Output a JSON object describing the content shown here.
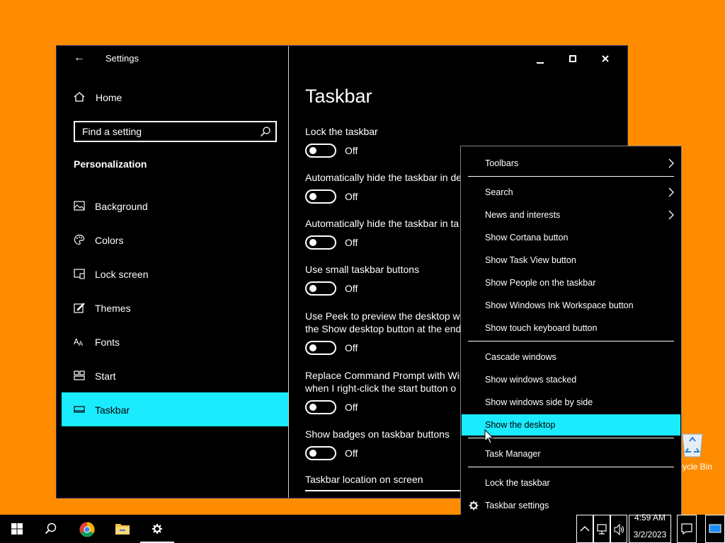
{
  "desktop": {
    "recycle_bin_label": "cycle Bin"
  },
  "window": {
    "app_title": "Settings",
    "home_label": "Home",
    "search_placeholder": "Find a setting",
    "section_title": "Personalization",
    "nav_items": [
      {
        "label": "Background",
        "icon": "image-icon"
      },
      {
        "label": "Colors",
        "icon": "palette-icon"
      },
      {
        "label": "Lock screen",
        "icon": "lock-screen-icon"
      },
      {
        "label": "Themes",
        "icon": "themes-icon"
      },
      {
        "label": "Fonts",
        "icon": "fonts-icon"
      },
      {
        "label": "Start",
        "icon": "start-icon"
      },
      {
        "label": "Taskbar",
        "icon": "taskbar-icon",
        "active": true
      }
    ]
  },
  "content": {
    "page_title": "Taskbar",
    "settings": [
      {
        "title": "Lock the taskbar",
        "state": "Off"
      },
      {
        "title": "Automatically hide the taskbar in de",
        "state": "Off"
      },
      {
        "title": "Automatically hide the taskbar in ta",
        "state": "Off"
      },
      {
        "title": "Use small taskbar buttons",
        "state": "Off"
      },
      {
        "title": "Use Peek to preview the desktop wh",
        "title2": "the Show desktop button at the end",
        "state": "Off"
      },
      {
        "title": "Replace Command Prompt with Win",
        "title2": "when I right-click the start button o",
        "state": "Off"
      },
      {
        "title": "Show badges on taskbar buttons",
        "state": "Off"
      }
    ],
    "location_label": "Taskbar location on screen"
  },
  "context_menu": {
    "items": [
      {
        "label": "Toolbars",
        "submenu": true
      },
      {
        "label": "Search",
        "submenu": true
      },
      {
        "label": "News and interests",
        "submenu": true
      },
      {
        "label": "Show Cortana button"
      },
      {
        "label": "Show Task View button"
      },
      {
        "label": "Show People on the taskbar"
      },
      {
        "label": "Show Windows Ink Workspace button"
      },
      {
        "label": "Show touch keyboard button"
      },
      {
        "label": "Cascade windows"
      },
      {
        "label": "Show windows stacked"
      },
      {
        "label": "Show windows side by side"
      },
      {
        "label": "Show the desktop",
        "highlighted": true
      },
      {
        "label": "Task Manager"
      },
      {
        "label": "Lock the taskbar"
      },
      {
        "label": "Taskbar settings",
        "icon": "gear-icon"
      }
    ]
  },
  "taskbar": {
    "clock_time": "4:59 AM",
    "clock_date": "3/2/2023",
    "accent_color": "#1aebff"
  }
}
